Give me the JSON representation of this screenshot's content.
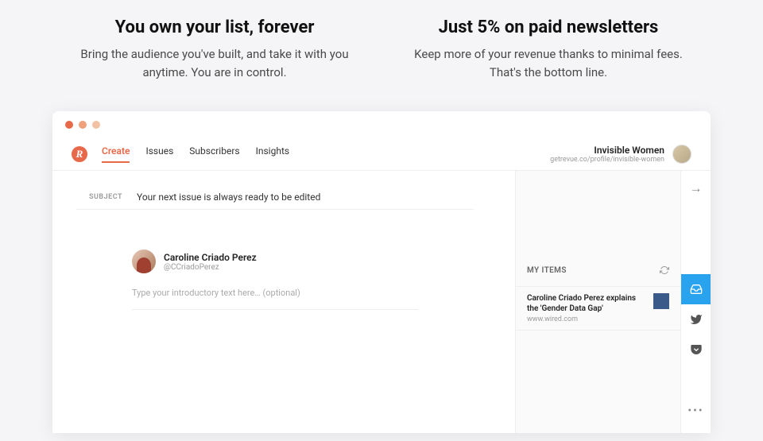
{
  "features": {
    "left": {
      "heading": "You own your list, forever",
      "body": "Bring the audience you've built, and take it with you anytime. You are in control."
    },
    "right": {
      "heading": "Just 5% on paid newsletters",
      "body": "Keep more of your revenue thanks to minimal fees. That's the bottom line."
    }
  },
  "app": {
    "logo_letter": "R",
    "nav": {
      "create": "Create",
      "issues": "Issues",
      "subscribers": "Subscribers",
      "insights": "Insights"
    },
    "profile": {
      "name": "Invisible Women",
      "url": "getrevue.co/profile/invisible-women"
    }
  },
  "editor": {
    "subject_label": "SUBJECT",
    "subject_value": "Your next issue is always ready to be edited",
    "author_name": "Caroline Criado Perez",
    "author_handle": "@CCriadoPerez",
    "intro_placeholder": "Type your introductory text here… (optional)"
  },
  "sidebar": {
    "title": "MY ITEMS",
    "item": {
      "title": "Caroline Criado Perez explains the 'Gender Data Gap'",
      "source": "www.wired.com"
    }
  }
}
